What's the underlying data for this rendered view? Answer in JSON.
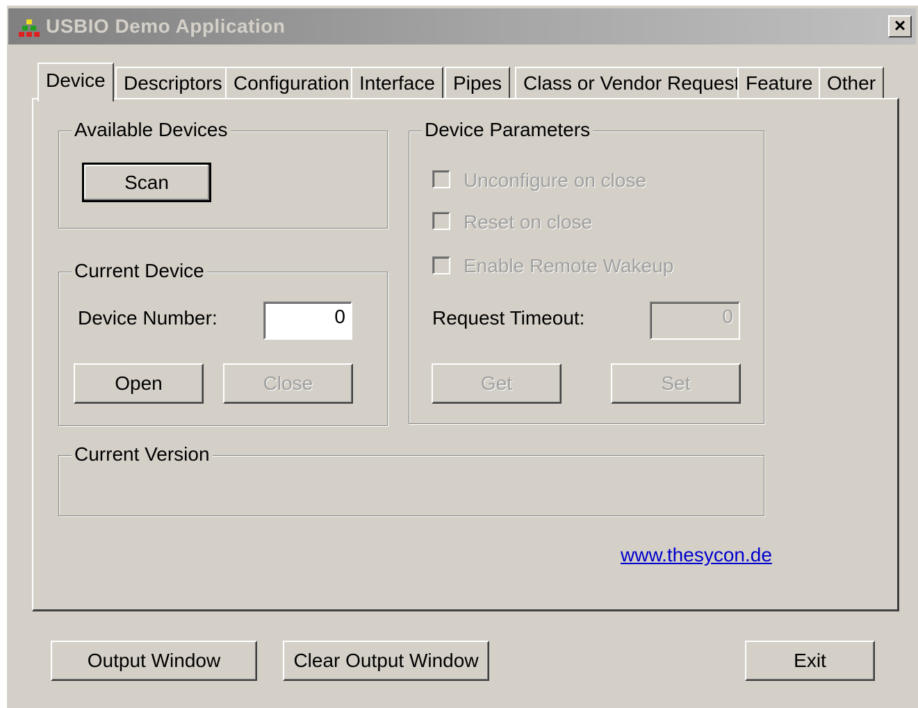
{
  "window": {
    "title": "USBIO Demo Application",
    "close_glyph": "×",
    "icon": "usbio-app-icon"
  },
  "tabs": [
    {
      "label": "Device",
      "active": true
    },
    {
      "label": "Descriptors"
    },
    {
      "label": "Configuration"
    },
    {
      "label": "Interface"
    },
    {
      "label": "Pipes"
    },
    {
      "label": "Class or Vendor Request"
    },
    {
      "label": "Feature"
    },
    {
      "label": "Other"
    }
  ],
  "available_devices": {
    "title": "Available Devices",
    "scan_label": "Scan"
  },
  "current_device": {
    "title": "Current Device",
    "device_number_label": "Device Number:",
    "device_number_value": "0",
    "open_label": "Open",
    "close_label": "Close"
  },
  "device_parameters": {
    "title": "Device Parameters",
    "unconfigure_label": "Unconfigure on close",
    "reset_label": "Reset on close",
    "remote_wakeup_label": "Enable Remote Wakeup",
    "request_timeout_label": "Request Timeout:",
    "request_timeout_value": "0",
    "get_label": "Get",
    "set_label": "Set"
  },
  "current_version": {
    "title": "Current Version",
    "value": ""
  },
  "link": {
    "text": "www.thesycon.de"
  },
  "footer": {
    "output_window_label": "Output Window",
    "clear_output_label": "Clear Output Window",
    "exit_label": "Exit"
  },
  "colors": {
    "face": "#d4d0c8",
    "link": "#0000cc",
    "disabled_text": "#a0a0a0"
  }
}
